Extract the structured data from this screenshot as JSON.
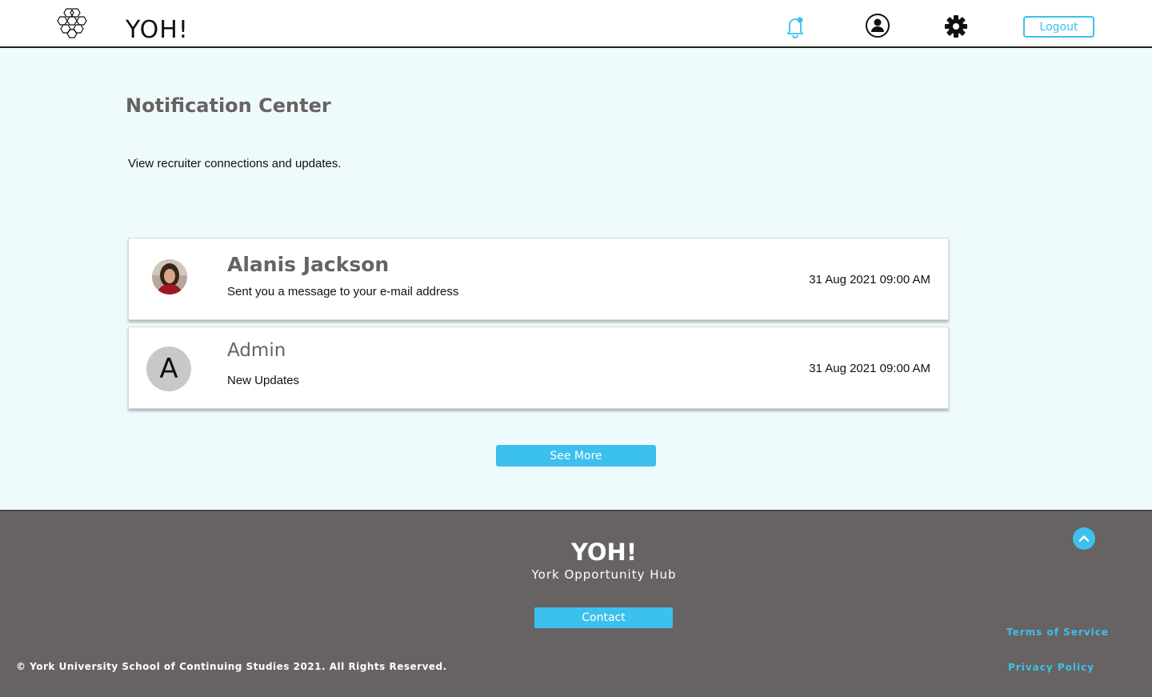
{
  "header": {
    "brand": "YOH!",
    "logout_label": "Logout",
    "icons": [
      "honeycomb-logo-icon",
      "bell-icon",
      "profile-icon",
      "gear-icon"
    ],
    "notification_dot_color": "#3cc0ee"
  },
  "main": {
    "title": "Notification Center",
    "subtitle": "View recruiter connections and updates.",
    "notifications": [
      {
        "name": "Alanis Jackson",
        "message": "Sent you a message to your e-mail address",
        "timestamp": "31 Aug 2021 09:00 AM",
        "avatar": "photo"
      },
      {
        "name": "Admin",
        "message": "New Updates",
        "timestamp": "31 Aug 2021 09:00 AM",
        "avatar_letter": "A"
      }
    ],
    "see_more_label": "See More"
  },
  "footer": {
    "brand": "YOH!",
    "tagline": "York Opportunity Hub",
    "contact_label": "Contact",
    "terms_label": "Terms of Service",
    "privacy_label": "Privacy Policy",
    "copyright": "© York University School of Continuing Studies 2021. All Rights Reserved."
  },
  "colors": {
    "accent": "#3cc0ee",
    "page_bg": "#eefafc",
    "footer_bg": "#676362",
    "heading": "#676362"
  }
}
